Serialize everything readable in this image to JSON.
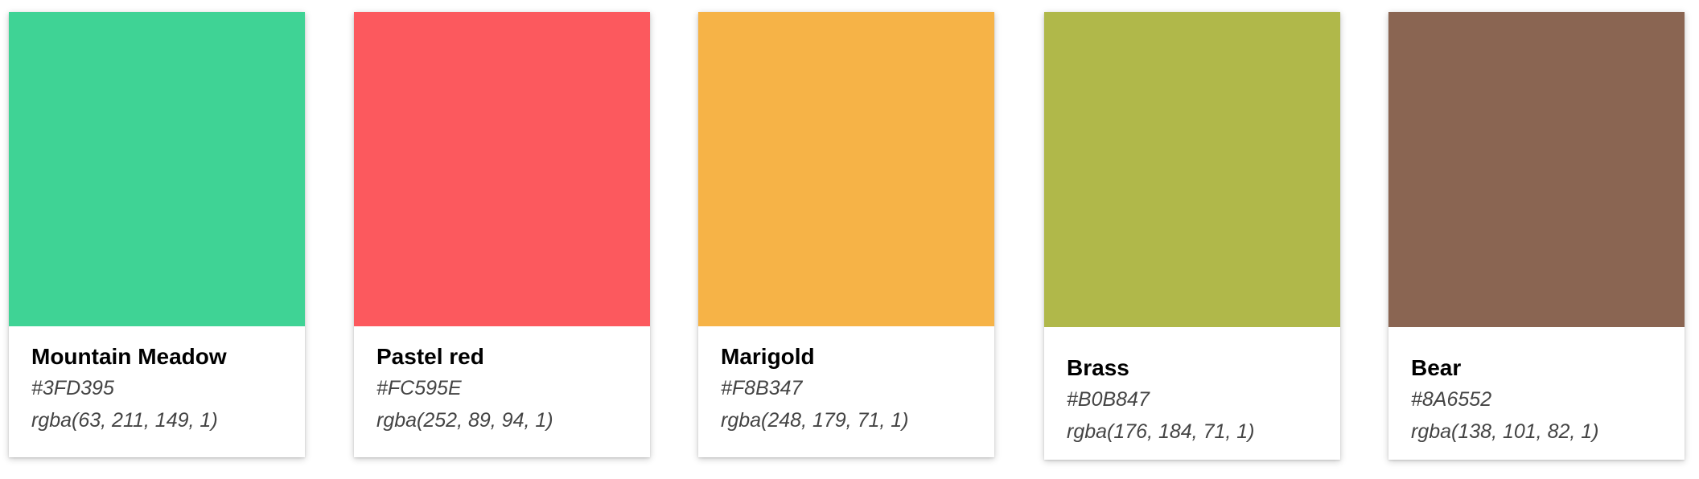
{
  "palette": [
    {
      "name": "Mountain Meadow",
      "hex": "#3FD395",
      "rgba": "rgba(63, 211, 149, 1)",
      "color": "#3FD395"
    },
    {
      "name": "Pastel red",
      "hex": "#FC595E",
      "rgba": "rgba(252, 89, 94, 1)",
      "color": "#FC595E"
    },
    {
      "name": "Marigold",
      "hex": "#F8B347",
      "rgba": "rgba(248, 179, 71, 1)",
      "color": "#F6B347"
    },
    {
      "name": "Brass",
      "hex": "#B0B847",
      "rgba": "rgba(176, 184, 71, 1)",
      "color": "#B0B84A"
    },
    {
      "name": "Bear",
      "hex": "#8A6552",
      "rgba": "rgba(138, 101, 82, 1)",
      "color": "#8A6552"
    }
  ]
}
